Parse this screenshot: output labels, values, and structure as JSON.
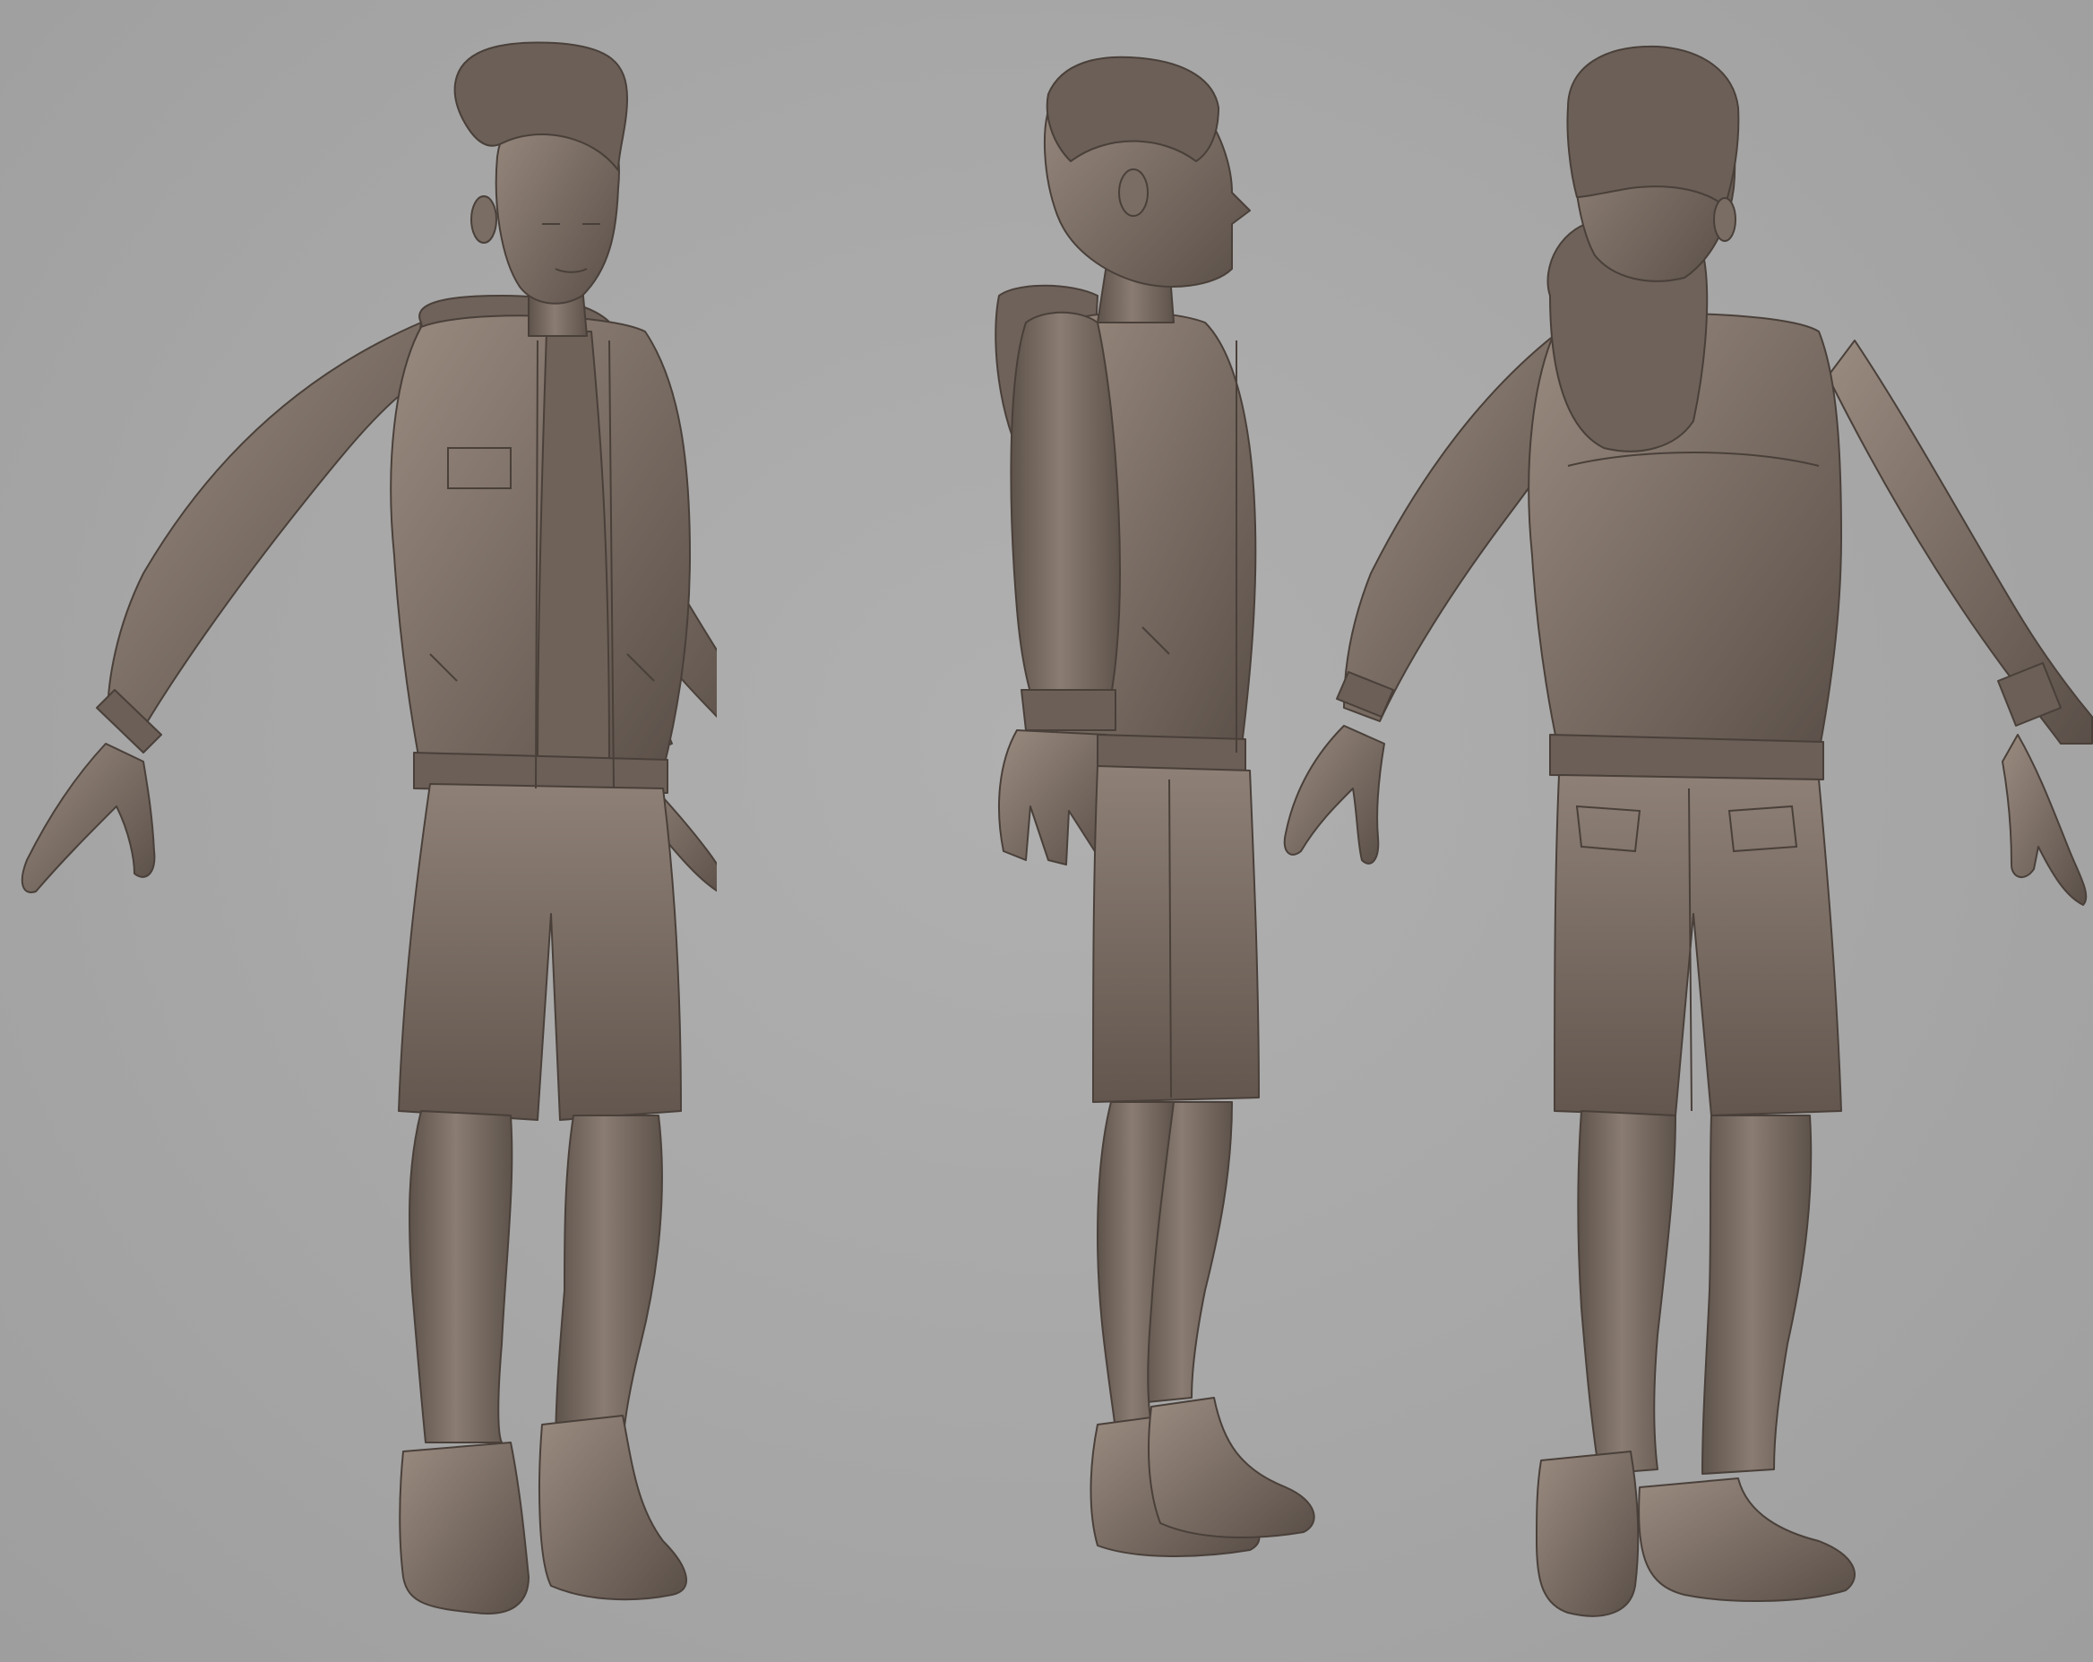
{
  "scene": {
    "background_color": "#a7a7a7",
    "clay_color": "#7a6d64",
    "clay_light": "#9a8b80",
    "clay_dark": "#574c45",
    "views": [
      {
        "name": "front-three-quarter-view"
      },
      {
        "name": "side-profile-view"
      },
      {
        "name": "back-three-quarter-view"
      }
    ]
  }
}
